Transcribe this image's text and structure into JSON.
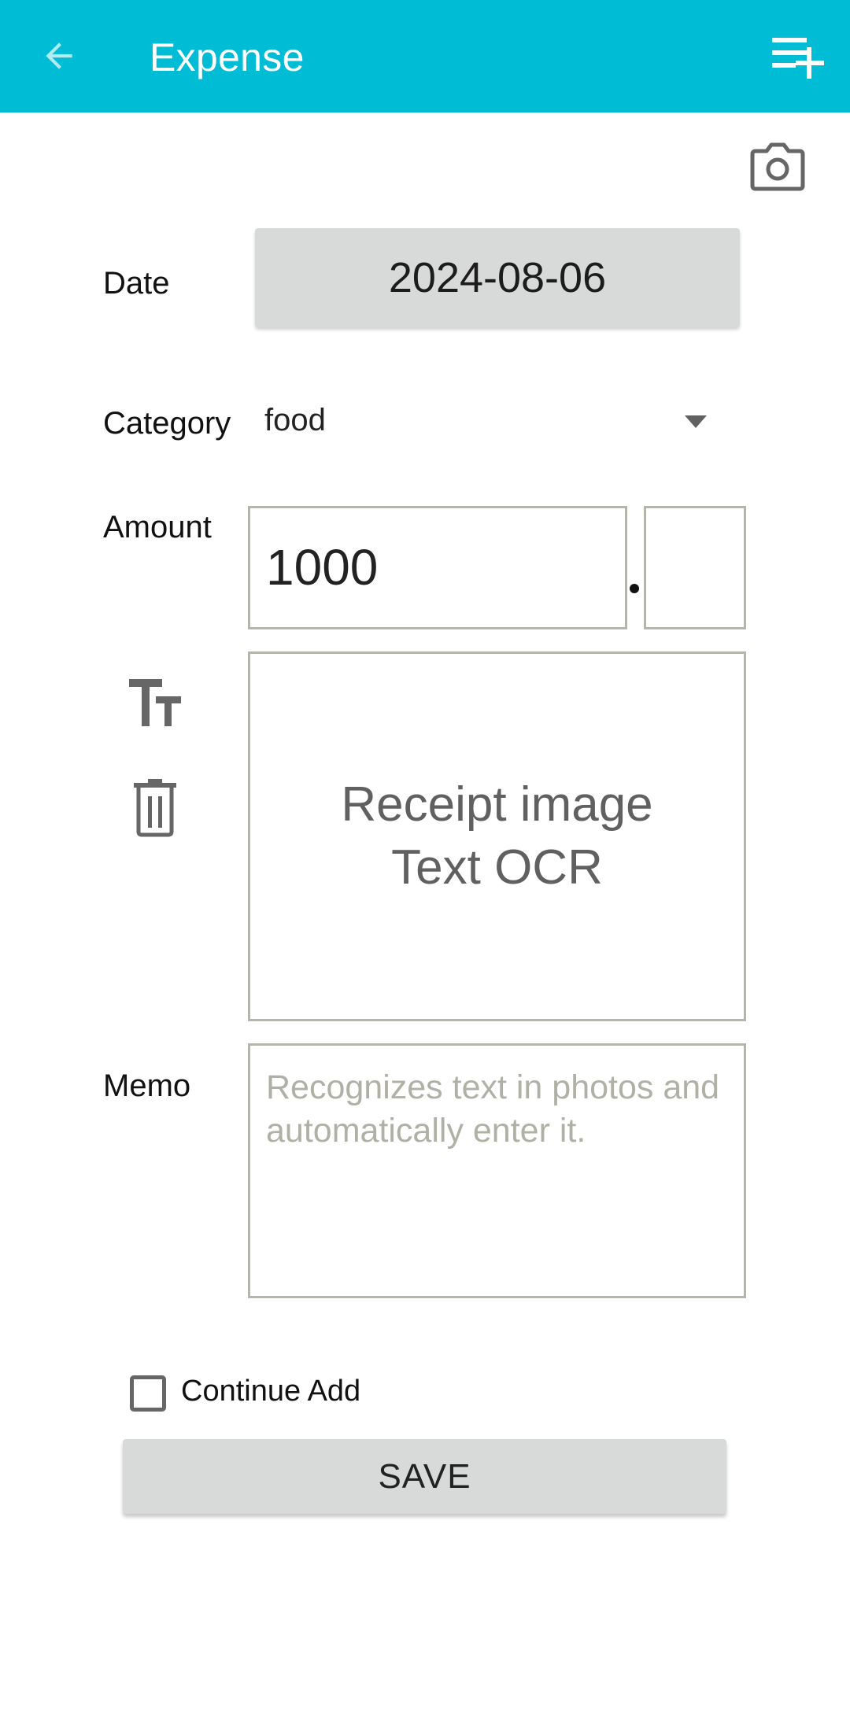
{
  "appbar": {
    "title": "Expense",
    "back_icon": "arrow-back-icon",
    "action_icon": "playlist-add-icon",
    "color": "#00BCD4"
  },
  "camera": {
    "icon": "camera-icon"
  },
  "form": {
    "date": {
      "label": "Date",
      "value": "2024-08-06"
    },
    "category": {
      "label": "Category",
      "value": "food",
      "icon": "dropdown-arrow-icon"
    },
    "amount": {
      "label": "Amount",
      "integer_value": "1000",
      "separator": ".",
      "decimal_value": ""
    },
    "ocr": {
      "line1": "Receipt image",
      "line2": "Text OCR",
      "text_icon": "text-size-icon",
      "delete_icon": "trash-icon"
    },
    "memo": {
      "label": "Memo",
      "value": "",
      "placeholder": "Recognizes text in photos and automatically enter it."
    },
    "continue_add": {
      "label": "Continue Add",
      "checked": false
    },
    "save_label": "SAVE"
  }
}
